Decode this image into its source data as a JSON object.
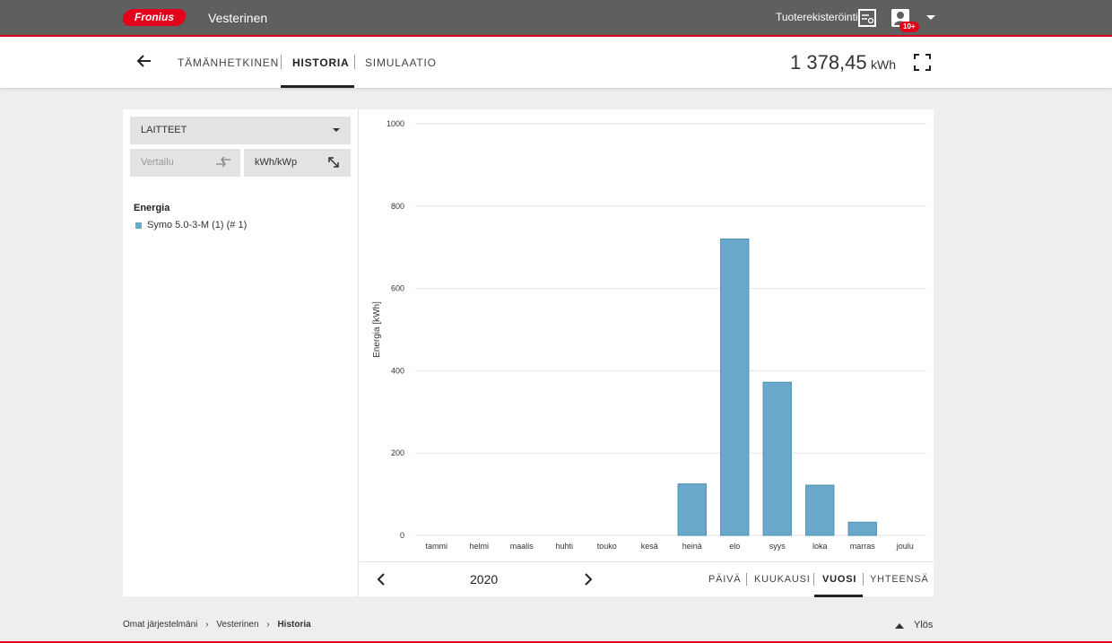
{
  "header": {
    "logo_text": "Fronius",
    "site_name": "Vesterinen",
    "registration_label": "Tuoterekisteröinti",
    "notification_badge": "10+",
    "brand_color": "#e2001a"
  },
  "subnav": {
    "tabs": [
      {
        "label": "TÄMÄNHETKINEN"
      },
      {
        "label": "HISTORIA"
      },
      {
        "label": "SIMULAATIO"
      }
    ],
    "active_tab": "HISTORIA",
    "total_value": "1 378,45",
    "total_unit": "kWh"
  },
  "left_panel": {
    "dropdown_label": "LAITTEET",
    "compare_label": "Vertailu",
    "kwp_label": "kWh/kWp",
    "legend_title": "Energia",
    "legend_item": "Symo 5.0-3-M (1) (# 1)"
  },
  "chart_data": {
    "type": "bar",
    "categories": [
      "tammi",
      "helmi",
      "maalis",
      "huhti",
      "touko",
      "kesä",
      "heinä",
      "elo",
      "syys",
      "loka",
      "marras",
      "joulu"
    ],
    "values": [
      0,
      0,
      0,
      0,
      0,
      0,
      125,
      720,
      372,
      122,
      32,
      0
    ],
    "ylabel": "Energia [kWh]",
    "ylim": [
      0,
      1000
    ],
    "yticks": [
      0,
      200,
      400,
      600,
      800,
      1000
    ],
    "grid": true,
    "bar_color": "#6aa9cb"
  },
  "bottom_bar": {
    "year": "2020",
    "periods": [
      {
        "label": "PÄIVÄ"
      },
      {
        "label": "KUUKAUSI"
      },
      {
        "label": "VUOSI"
      },
      {
        "label": "YHTEENSÄ"
      }
    ],
    "active_period": "VUOSI"
  },
  "footer": {
    "breadcrumb": [
      "Omat järjestelmäni",
      "Vesterinen",
      "Historia"
    ],
    "up_label": "Ylös"
  }
}
